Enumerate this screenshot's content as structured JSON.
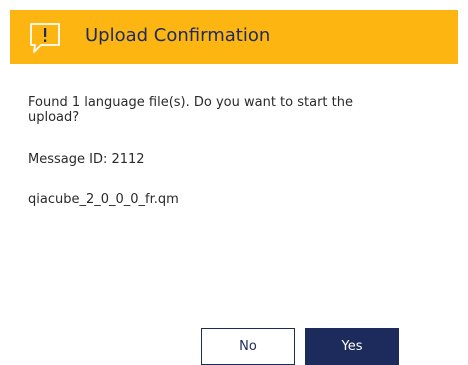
{
  "dialog": {
    "title": "Upload Confirmation",
    "header_icon": "speech-bubble-exclamation-icon",
    "message": "Found 1 language file(s). Do you want to start the upload?",
    "message_id": "Message ID: 2112",
    "file_name": "qiacube_2_0_0_0_fr.qm"
  },
  "buttons": {
    "no_label": "No",
    "yes_label": "Yes"
  },
  "colors": {
    "header_background": "#FDB511",
    "primary": "#1d2b5c",
    "text": "#2a2a2a"
  }
}
